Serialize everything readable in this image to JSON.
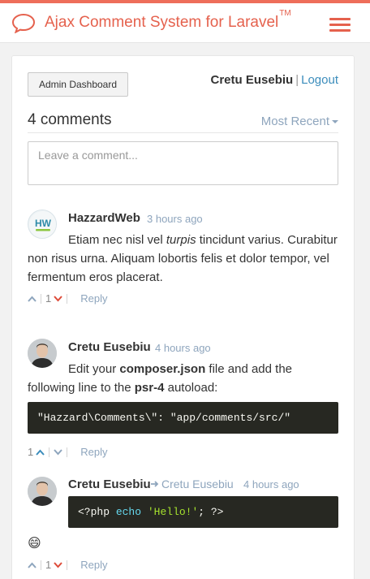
{
  "header": {
    "title": "Ajax Comment System for Laravel",
    "trademark": "TM",
    "brand_color": "#e5614d",
    "logo_icon": "speech-bubble-icon",
    "menu_icon": "hamburger-menu-icon"
  },
  "toolbar": {
    "admin_label": "Admin Dashboard",
    "user_name": "Cretu Eusebiu",
    "separator": "|",
    "logout_label": "Logout"
  },
  "comments_header": {
    "count_label": "4 comments",
    "sort_label": "Most Recent"
  },
  "new_comment": {
    "placeholder": "Leave a comment..."
  },
  "comments": [
    {
      "author": "HazzardWeb",
      "time": "3 hours ago",
      "text_before": "Etiam nec nisl vel ",
      "text_italic": "turpis",
      "text_after": " tincidunt varius. Curabitur non risus urna. Aliquam lobortis felis et dolor tempor, vel fermentum eros placerat.",
      "downvotes": "1",
      "reply_label": "Reply"
    },
    {
      "author": "Cretu Eusebiu",
      "time": "4 hours ago",
      "text_1": "Edit your ",
      "text_bold_1": "composer.json",
      "text_2": " file and add the following line to the ",
      "text_bold_2": "psr-4",
      "text_3": " autoload:",
      "code": "\"Hazzard\\Comments\\\": \"app/comments/src/\"",
      "upvotes": "1",
      "reply_label": "Reply"
    },
    {
      "author": "Cretu Eusebiu",
      "reply_to": "Cretu Eusebiu",
      "time": "4 hours ago",
      "code_tag": "<?php",
      "code_fn": "echo",
      "code_str": "'Hello!'",
      "code_end": "; ?>",
      "emoji": "😄",
      "downvotes": "1",
      "reply_label": "Reply"
    }
  ],
  "colors": {
    "accent": "#ee6e5a",
    "link": "#3c8dbc",
    "muted": "#8ea5bd",
    "upvote": "#3c8dbc",
    "downvote": "#dd4b39",
    "code_bg": "#272822"
  }
}
